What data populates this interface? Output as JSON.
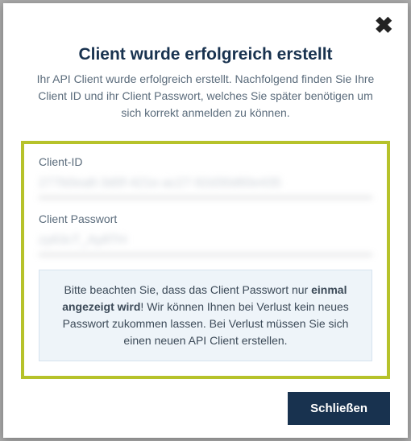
{
  "modal": {
    "title": "Client wurde erfolgreich erstellt",
    "subtitle": "Ihr API Client wurde erfolgreich erstellt. Nachfolgend finden Sie Ihre Client ID und ihr Client Passwort, welches Sie später benötigen um sich korrekt anmelden zu können.",
    "client_id_label": "Client-ID",
    "client_id_value": "277b0ea8-3d0f-421e-ac27-92d30d60e435",
    "client_password_label": "Client Passwort",
    "client_password_value": "zy63cT_Ay8TH",
    "notice_prefix": "Bitte beachten Sie, dass das Client Passwort nur ",
    "notice_bold": "einmal angezeigt wird",
    "notice_suffix": "! Wir können Ihnen bei Verlust kein neues Passwort zukommen lassen. Bei Verlust müssen Sie sich einen neuen API Client erstellen.",
    "close_button": "Schließen"
  }
}
